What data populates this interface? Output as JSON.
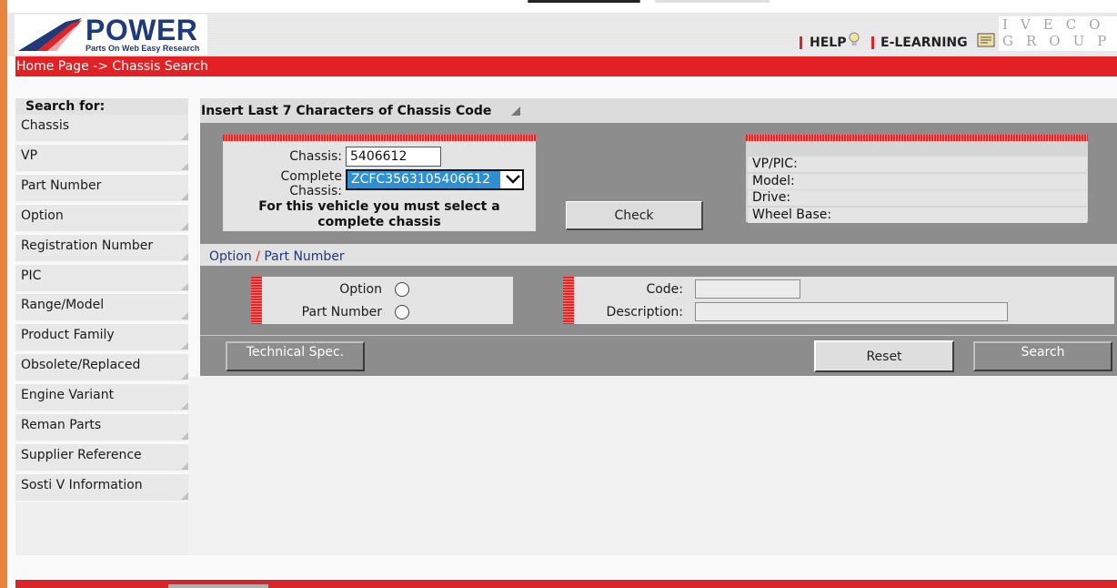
{
  "header": {
    "logo_title": "POWER",
    "logo_subtitle": "Parts On Web Easy Research",
    "help_label": "HELP",
    "elearning_label": "E-LEARNING",
    "group_mark": "IVECO GROUP"
  },
  "breadcrumb": "Home Page -> Chassis Search",
  "sidebar": {
    "title": "Search for:",
    "items": [
      {
        "label": "Chassis"
      },
      {
        "label": "VP"
      },
      {
        "label": "Part Number"
      },
      {
        "label": "Option"
      },
      {
        "label": "Registration Number"
      },
      {
        "label": "PIC"
      },
      {
        "label": "Range/Model"
      },
      {
        "label": "Product Family"
      },
      {
        "label": "Obsolete/Replaced"
      },
      {
        "label": "Engine Variant"
      },
      {
        "label": "Reman Parts"
      },
      {
        "label": "Supplier Reference"
      },
      {
        "label": "Sosti V Information"
      }
    ]
  },
  "chassis_section": {
    "title": "Insert Last 7 Characters of Chassis Code",
    "chassis_label": "Chassis:",
    "chassis_value": "5406612",
    "complete_label": "Complete\nChassis:",
    "complete_value": "ZCFC3563105406612",
    "warning": "For this vehicle you must select a complete chassis",
    "check_label": "Check"
  },
  "vehicle_info": {
    "rows": [
      {
        "label": "VP/PIC:"
      },
      {
        "label": "Model:"
      },
      {
        "label": "Drive:"
      },
      {
        "label": "Wheel Base:"
      }
    ]
  },
  "option_section": {
    "title_option": "Option",
    "title_slash": "/",
    "title_part": "Part Number",
    "radio_option_label": "Option",
    "radio_part_label": "Part Number",
    "code_label": "Code:",
    "code_value": "",
    "description_label": "Description:",
    "description_value": ""
  },
  "actions": {
    "tech_spec_label": "Technical Spec.",
    "reset_label": "Reset",
    "search_label": "Search"
  },
  "colors": {
    "accent_red": "#e32124",
    "brand_blue": "#1f3a78",
    "panel_gray": "#8d8d8d",
    "selected_blue": "#2f8fd0"
  },
  "icons": [
    "help-bulb-icon",
    "elearning-book-icon",
    "chevron-down-icon",
    "section-corner-icon"
  ]
}
